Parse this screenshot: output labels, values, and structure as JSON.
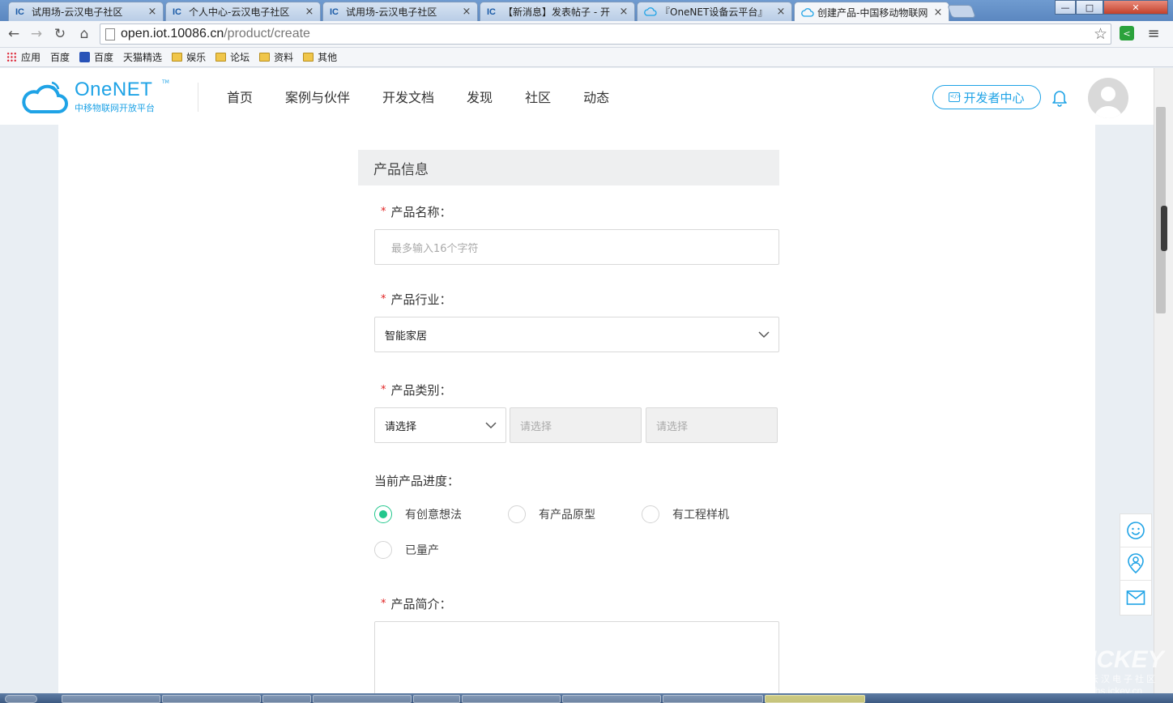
{
  "browser": {
    "tabs": [
      {
        "icon": "IC",
        "title": "试用场-云汉电子社区",
        "close": "×"
      },
      {
        "icon": "IC",
        "title": "个人中心-云汉电子社区",
        "close": "×"
      },
      {
        "icon": "IC",
        "title": "试用场-云汉电子社区",
        "close": "×"
      },
      {
        "icon": "IC",
        "title": "【新消息】发表帖子 - 开",
        "close": "×"
      },
      {
        "icon": "cloud",
        "title": "『OneNET设备云平台』",
        "close": "×"
      },
      {
        "icon": "cloud",
        "title": "创建产品-中国移动物联网",
        "close": "×"
      }
    ],
    "window_controls": {
      "minimize": "—",
      "maximize": "□",
      "close": "✕"
    },
    "url_host": "open.iot.10086.cn",
    "url_path": "/product/create",
    "bookmarks": [
      {
        "icon": "apps-grid",
        "label": "应用"
      },
      {
        "icon": "page",
        "label": "百度"
      },
      {
        "icon": "baidu-paw",
        "label": "百度"
      },
      {
        "icon": "page",
        "label": "天猫精选"
      },
      {
        "icon": "folder",
        "label": "娱乐"
      },
      {
        "icon": "folder",
        "label": "论坛"
      },
      {
        "icon": "folder",
        "label": "资料"
      },
      {
        "icon": "folder",
        "label": "其他"
      }
    ]
  },
  "site": {
    "logo_brand": "OneNET",
    "logo_tm": "TM",
    "logo_sub": "中移物联网开放平台",
    "nav": [
      "首页",
      "案例与伙伴",
      "开发文档",
      "发现",
      "社区",
      "动态"
    ],
    "dev_center": "开发者中心",
    "brand_color": "#1fa3e6"
  },
  "form": {
    "section_title": "产品信息",
    "required_mark": "*",
    "name_label": "产品名称：",
    "name_placeholder": "最多输入16个字符",
    "industry_label": "产品行业：",
    "industry_value": "智能家居",
    "category_label": "产品类别：",
    "category_values": [
      "请选择",
      "请选择",
      "请选择"
    ],
    "progress_label": "当前产品进度：",
    "progress_options": [
      {
        "label": "有创意想法",
        "checked": true
      },
      {
        "label": "有产品原型",
        "checked": false
      },
      {
        "label": "有工程样机",
        "checked": false
      },
      {
        "label": "已量产",
        "checked": false
      }
    ],
    "intro_label": "产品简介：",
    "accent_color": "#23c78d"
  },
  "side_buttons": [
    "smile-icon",
    "location-user-icon",
    "mail-icon"
  ],
  "watermark": {
    "line1": "ICKEY",
    "line2": "云汉电子社区",
    "line3": "bbs.ickey.cn"
  }
}
